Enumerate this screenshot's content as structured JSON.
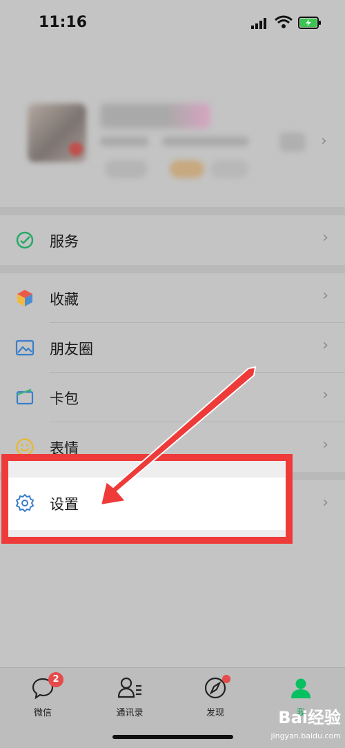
{
  "status": {
    "time": "11:16"
  },
  "menu": {
    "service": "服务",
    "favorites": "收藏",
    "moments": "朋友圈",
    "cards": "卡包",
    "stickers": "表情",
    "settings": "设置"
  },
  "tabs": [
    {
      "label": "微信",
      "badge": "2"
    },
    {
      "label": "通讯录"
    },
    {
      "label": "发现"
    },
    {
      "label": "我"
    }
  ],
  "watermark": {
    "brand": "Bai经验",
    "url": "jingyan.baidu.com"
  },
  "colors": {
    "accent": "#07c160",
    "highlight": "#ef3a3a",
    "badge": "#e54b4b"
  }
}
